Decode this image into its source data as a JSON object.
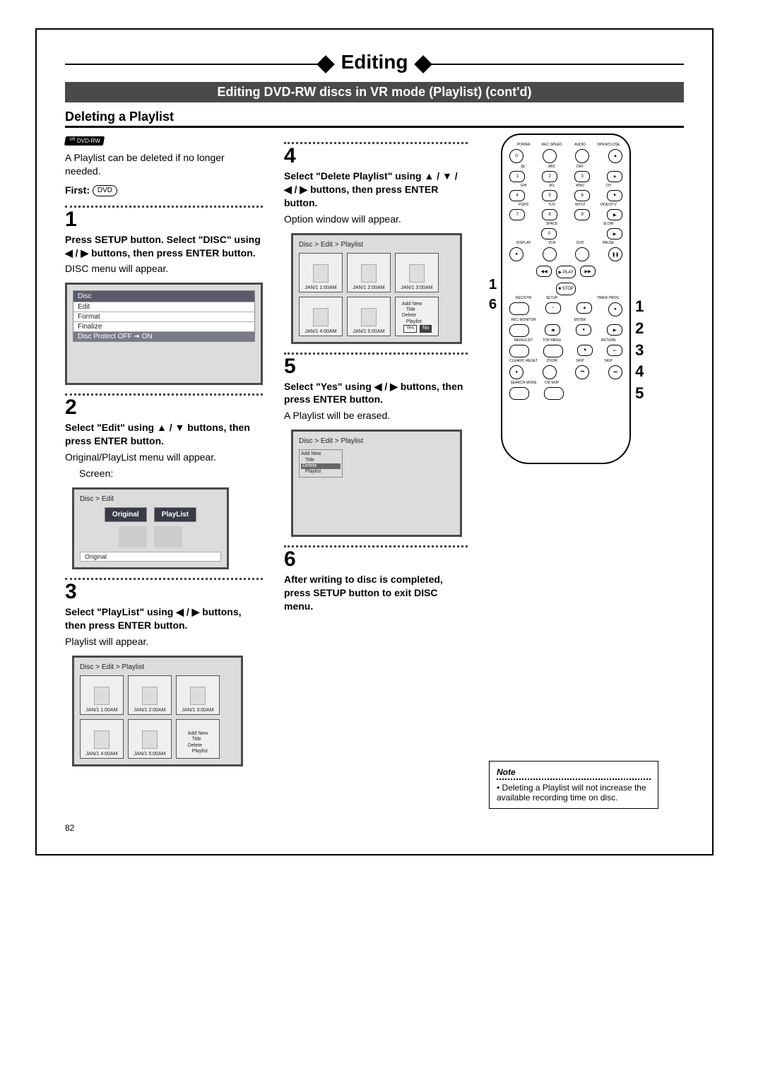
{
  "header": {
    "section_title": "Editing",
    "subtitle": "Editing DVD-RW discs in VR mode (Playlist) (cont'd)"
  },
  "topic": {
    "title": "Deleting a Playlist"
  },
  "intro": {
    "badge": "DVD-RW",
    "badge_sup": "VR",
    "text": "A Playlist can be deleted if no longer needed.",
    "first_label": "First:",
    "first_badge": "DVD"
  },
  "steps": {
    "s1": {
      "num": "1",
      "bold": "Press SETUP button. Select \"DISC\" using ◀ / ▶ buttons, then press ENTER button.",
      "text": "DISC menu will appear.",
      "menu": {
        "header": "Disc",
        "items": [
          "Edit",
          "Format",
          "Finalize",
          "Disc Protect OFF ➔ ON"
        ]
      }
    },
    "s2": {
      "num": "2",
      "bold": "Select \"Edit\" using ▲ / ▼ buttons, then press ENTER button.",
      "text": "Original/PlayList menu will appear.",
      "text2": "Screen:",
      "screen": {
        "bc": "Disc > Edit",
        "tabs": [
          "Original",
          "PlayList"
        ],
        "footer": "Original"
      }
    },
    "s3": {
      "num": "3",
      "bold": "Select \"PlayList\" using ◀ / ▶ buttons, then press ENTER button.",
      "text": "Playlist will appear.",
      "screen": {
        "bc": "Disc > Edit > Playlist",
        "thumbs": [
          "JAN/1  1:00AM",
          "JAN/1  2:00AM",
          "JAN/1  3:00AM",
          "JAN/1  4:00AM",
          "JAN/1  5:00AM"
        ],
        "last": {
          "l1": "Add New",
          "l2": "Title",
          "l3": "Delete",
          "l4": "Playlist"
        }
      }
    },
    "s4": {
      "num": "4",
      "bold": "Select \"Delete Playlist\" using ▲ / ▼ / ◀ / ▶ buttons, then press ENTER button.",
      "text": "Option window will appear.",
      "screen": {
        "bc": "Disc > Edit > Playlist",
        "thumbs": [
          "JAN/1  1:00AM",
          "JAN/1  2:00AM",
          "JAN/1  3:00AM",
          "JAN/1  4:00AM",
          "JAN/1  5:00AM"
        ],
        "last": {
          "l1": "Add New",
          "l2": "Title",
          "l3": "Delete",
          "l4": "Playlist",
          "yes": "Yes",
          "no": "No"
        }
      }
    },
    "s5": {
      "num": "5",
      "bold": "Select \"Yes\" using ◀ / ▶ buttons, then press ENTER button.",
      "text": "A Playlist will be erased.",
      "screen": {
        "bc": "Disc > Edit > Playlist",
        "menu": {
          "l1": "Add New",
          "l2": "Title",
          "l3": "Delete",
          "l4": "Playlist"
        }
      }
    },
    "s6": {
      "num": "6",
      "bold": "After writing to disc is completed, press SETUP button to exit DISC menu."
    }
  },
  "remote": {
    "side_left": [
      "1",
      "6"
    ],
    "side_right": [
      "1",
      "2",
      "3",
      "4",
      "5"
    ],
    "top_labels": [
      "POWER",
      "REC SPEED",
      "AUDIO",
      "OPEN/CLOSE"
    ],
    "row1": [
      "@/.",
      "ABC",
      "DEF",
      ""
    ],
    "row1n": [
      "1",
      "2",
      "3",
      "▲"
    ],
    "row2": [
      "GHI",
      "JKL",
      "MNO",
      "CH"
    ],
    "row2n": [
      "4",
      "5",
      "6",
      "▼"
    ],
    "row3": [
      "PQRS",
      "TUV",
      "WXYZ",
      "VIDEO/TV"
    ],
    "row3n": [
      "7",
      "8",
      "9",
      "▶"
    ],
    "row4": [
      "",
      "SPACE",
      "",
      "SLOW"
    ],
    "row4n": [
      "",
      "0",
      "",
      "▶"
    ],
    "row5": [
      "DISPLAY",
      "VCR",
      "DVD",
      "PAUSE"
    ],
    "arrows": {
      "left": "◀◀",
      "play": "▶ PLAY",
      "right": "▶▶",
      "stop": "■  STOP"
    },
    "row6": [
      "REC/OTR",
      "SETUP",
      "",
      "TIMER PROG."
    ],
    "row6b": [
      "REC MONITOR",
      "",
      "ENTER",
      ""
    ],
    "row7": [
      "MENU/LIST",
      "TOP MENU",
      "",
      "RETURN"
    ],
    "row8": [
      "CLEAR/C-RESET",
      "ZOOM",
      "SKIP",
      "SKIP"
    ],
    "row9": [
      "SEARCH MODE",
      "CM SKIP",
      "",
      ""
    ]
  },
  "note": {
    "title": "Note",
    "text": "Deleting a Playlist will not increase the available recording time on disc."
  },
  "page_number": "82"
}
